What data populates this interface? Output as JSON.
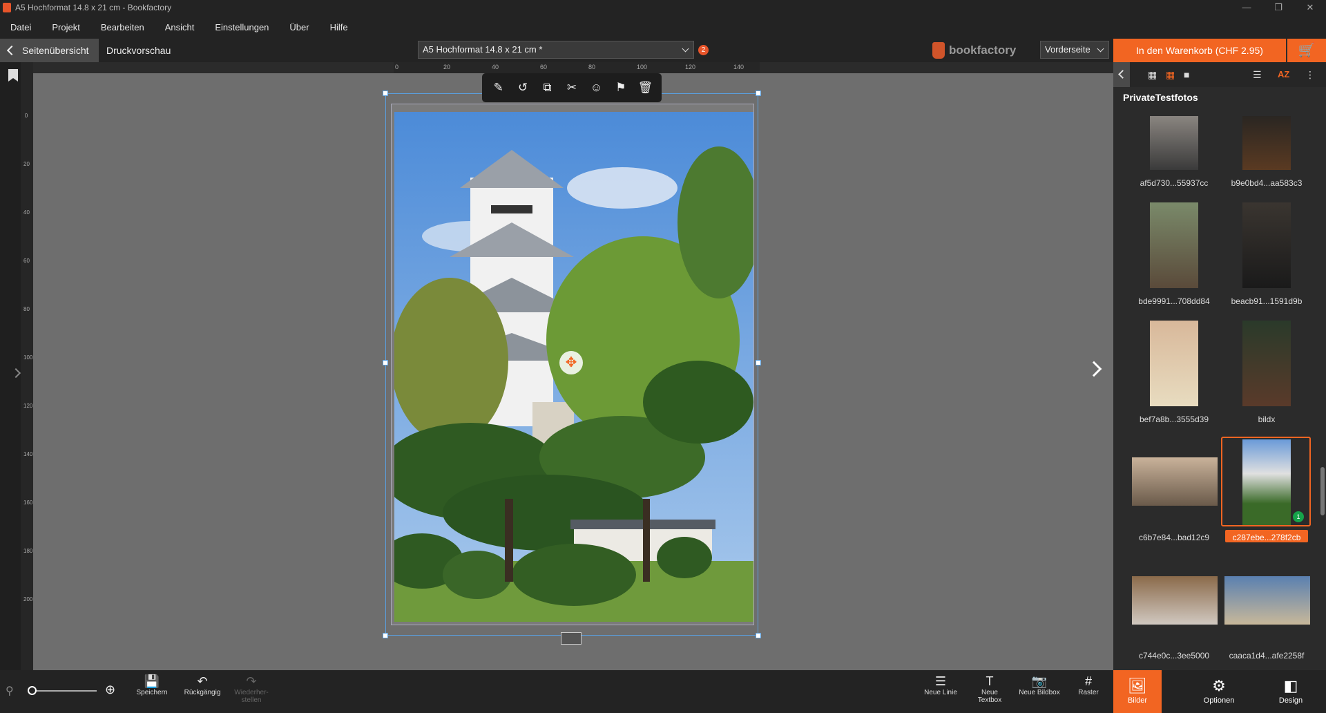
{
  "window": {
    "title": "A5 Hochformat 14.8 x 21 cm - Bookfactory"
  },
  "menu": [
    "Datei",
    "Projekt",
    "Bearbeiten",
    "Ansicht",
    "Einstellungen",
    "Über",
    "Hilfe"
  ],
  "toolbar": {
    "back_label": "Seitenübersicht",
    "preview_label": "Druckvorschau",
    "format_value": "A5 Hochformat 14.8 x 21 cm *",
    "notification_count": "2",
    "brand": "bookfactory",
    "side_value": "Vorderseite",
    "cart_label": "In den Warenkorb (CHF 2.95)"
  },
  "ruler": {
    "h_ticks": [
      "0",
      "20",
      "40",
      "60",
      "80",
      "100",
      "120",
      "140"
    ],
    "v_ticks": [
      "0",
      "20",
      "40",
      "60",
      "80",
      "100",
      "120",
      "140",
      "160",
      "180",
      "200"
    ]
  },
  "panel": {
    "title": "PrivateTestfotos",
    "images": [
      {
        "label": "af5d730...55937cc",
        "selected": false
      },
      {
        "label": "b9e0bd4...aa583c3",
        "selected": false
      },
      {
        "label": "bde9991...708dd84",
        "selected": false
      },
      {
        "label": "beacb91...1591d9b",
        "selected": false
      },
      {
        "label": "bef7a8b...3555d39",
        "selected": false
      },
      {
        "label": "bildx",
        "selected": false
      },
      {
        "label": "c6b7e84...bad12c9",
        "selected": false
      },
      {
        "label": "c287ebe...278f2cb",
        "selected": true
      },
      {
        "label": "c744e0c...3ee5000",
        "selected": false
      },
      {
        "label": "caaca1d4...afe2258f",
        "selected": false
      }
    ],
    "used_count": "1"
  },
  "bottom": {
    "save": "Speichern",
    "undo": "Rückgängig",
    "redo": "Wiederher-stellen",
    "new_line": "Neue Linie",
    "new_textbox": "Neue Textbox",
    "new_imagebox": "Neue Bildbox",
    "grid": "Raster"
  },
  "panel_tabs": {
    "images": "Bilder",
    "options": "Optionen",
    "design": "Design"
  },
  "colors": {
    "accent": "#f26522",
    "badge_green": "#16a34a"
  }
}
